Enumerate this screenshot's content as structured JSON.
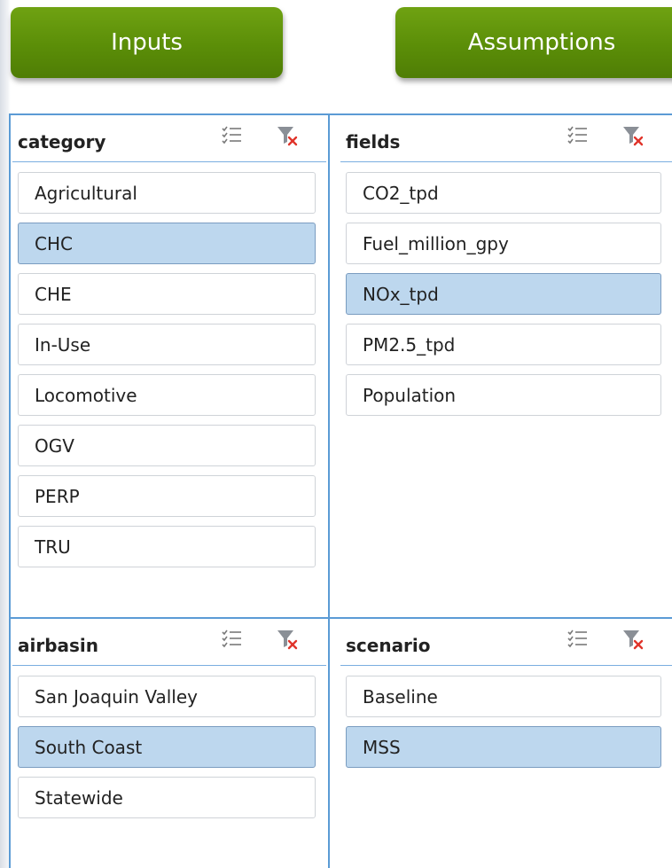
{
  "buttons": {
    "inputs": "Inputs",
    "assumptions": "Assumptions"
  },
  "slicers": {
    "category": {
      "title": "category",
      "items": [
        {
          "label": "Agricultural",
          "selected": false
        },
        {
          "label": "CHC",
          "selected": true
        },
        {
          "label": "CHE",
          "selected": false
        },
        {
          "label": "In-Use",
          "selected": false
        },
        {
          "label": "Locomotive",
          "selected": false
        },
        {
          "label": "OGV",
          "selected": false
        },
        {
          "label": "PERP",
          "selected": false
        },
        {
          "label": "TRU",
          "selected": false
        }
      ]
    },
    "fields": {
      "title": "fields",
      "items": [
        {
          "label": "CO2_tpd",
          "selected": false
        },
        {
          "label": "Fuel_million_gpy",
          "selected": false
        },
        {
          "label": "NOx_tpd",
          "selected": true
        },
        {
          "label": "PM2.5_tpd",
          "selected": false
        },
        {
          "label": "Population",
          "selected": false
        }
      ]
    },
    "airbasin": {
      "title": "airbasin",
      "items": [
        {
          "label": "San Joaquin Valley",
          "selected": false
        },
        {
          "label": "South Coast",
          "selected": true
        },
        {
          "label": "Statewide",
          "selected": false
        }
      ]
    },
    "scenario": {
      "title": "scenario",
      "items": [
        {
          "label": "Baseline",
          "selected": false
        },
        {
          "label": "MSS",
          "selected": true
        }
      ]
    }
  },
  "colors": {
    "button_green": "#5b8e08",
    "divider_blue": "#5b9bd5",
    "selected_item": "#bdd7ee"
  },
  "icons": {
    "multi_select": "multi-select-icon",
    "clear_filter": "clear-filter-icon"
  }
}
